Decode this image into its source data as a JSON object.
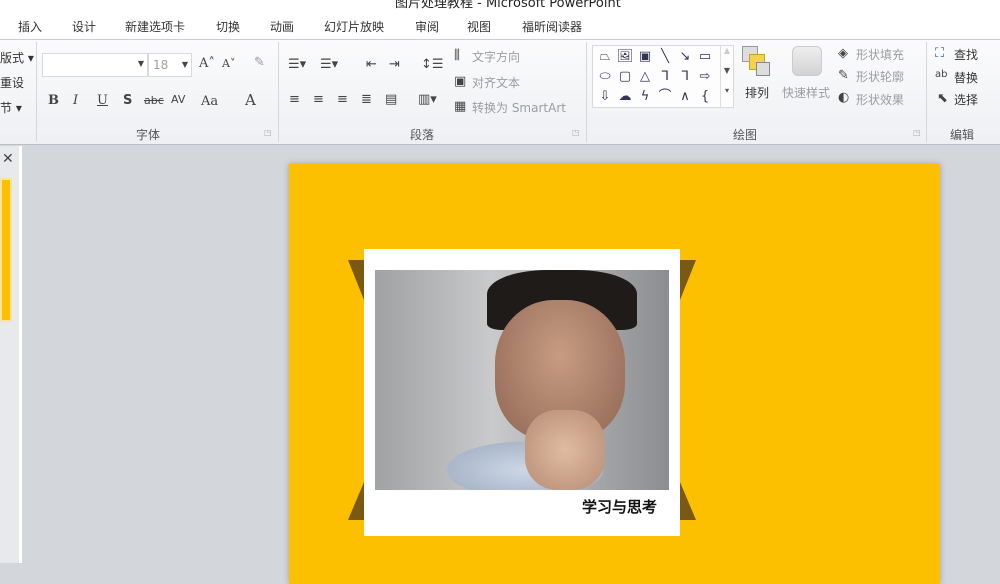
{
  "window": {
    "title": "图片处理教程 - Microsoft PowerPoint"
  },
  "tabs": [
    "插入",
    "设计",
    "新建选项卡",
    "切换",
    "动画",
    "幻灯片放映",
    "审阅",
    "视图",
    "福昕阅读器"
  ],
  "ribbon": {
    "slides_partial": [
      "版式 ▾",
      "重设",
      "节 ▾"
    ],
    "font": {
      "label": "字体",
      "font_name": "",
      "font_size": "18",
      "bold": "B",
      "italic": "I",
      "underline": "U",
      "shadow": "S",
      "strike": "abc",
      "spacing": "AV",
      "case": "Aa",
      "color": "A",
      "grow": "A˄",
      "shrink": "A˅"
    },
    "paragraph": {
      "label": "段落",
      "text_direction": "文字方向",
      "align_text": "对齐文本",
      "convert_smartart": "转换为 SmartArt"
    },
    "drawing": {
      "label": "绘图",
      "arrange": "排列",
      "quick_styles": "快速样式",
      "shape_fill": "形状填充",
      "shape_outline": "形状轮廓",
      "shape_effects": "形状效果",
      "shapes": [
        "⏢",
        "🖼",
        "▣",
        "╲",
        "↘",
        "▭",
        "⬭",
        "▢",
        "△",
        "ᒣ",
        "ᒣ",
        "⇨",
        "⇩",
        "☁",
        "ϟ",
        "⌒",
        "∧",
        "{"
      ]
    },
    "editing": {
      "label": "编辑",
      "find": "查找",
      "replace": "替换",
      "select": "选择"
    }
  },
  "slide": {
    "caption": "学习与思考",
    "background": "#fdc000",
    "accent": "#7a5a12"
  }
}
